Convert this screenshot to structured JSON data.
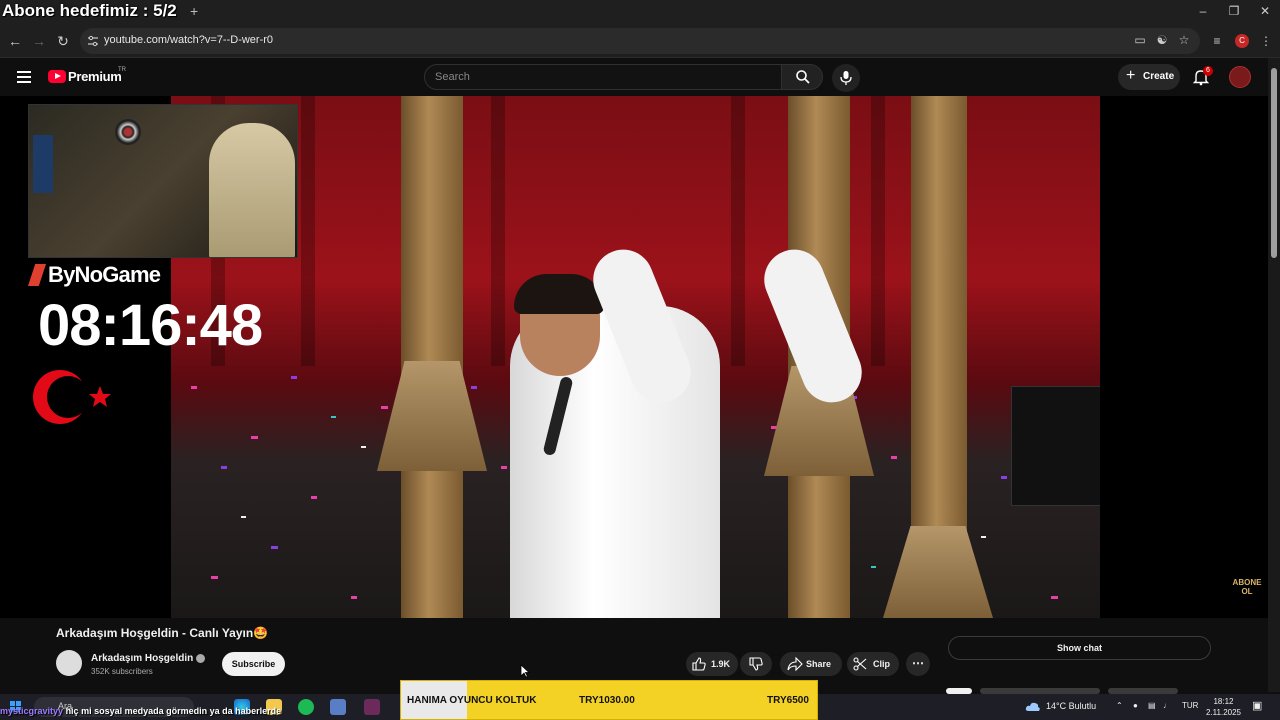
{
  "browser": {
    "tab_title": "Abone hedefimiz : 5/2",
    "new_tab": "+",
    "url": "youtube.com/watch?v=7--D-wer-r0",
    "profile_initial": "C"
  },
  "youtube": {
    "brand": "Premium",
    "country": "TR",
    "search_placeholder": "Search",
    "create_label": "Create",
    "notification_count": "6"
  },
  "overlay": {
    "channel_logo": "ByNoGame",
    "stream_time": "08:16:48",
    "abone_mark": "ABONE OL"
  },
  "video": {
    "title": "Arkadaşım Hoşgeldin - Canlı Yayın🤩",
    "channel": "Arkadaşım Hoşgeldin",
    "subscribers": "352K subscribers",
    "subscribe_label": "Subscribe",
    "likes": "1.9K",
    "share_label": "Share",
    "clip_label": "Clip",
    "show_chat_label": "Show chat"
  },
  "chat": {
    "user": "mysticgravityy",
    "message": "hiç mi sosyal medyada görmedin ya da haberlerde"
  },
  "promo": {
    "product": "HANIMA OYUNCU KOLTUK",
    "price": "TRY1030.00",
    "old_price": "TRY6500"
  },
  "taskbar": {
    "search_label": "Ara",
    "weather": "14°C  Bulutlu",
    "language": "TUR",
    "time": "18:12",
    "date": "2.11.2025"
  },
  "colors": {
    "youtube_red": "#ff0033",
    "promo_yellow": "#f4d225",
    "chat_user": "#9b7bff"
  }
}
